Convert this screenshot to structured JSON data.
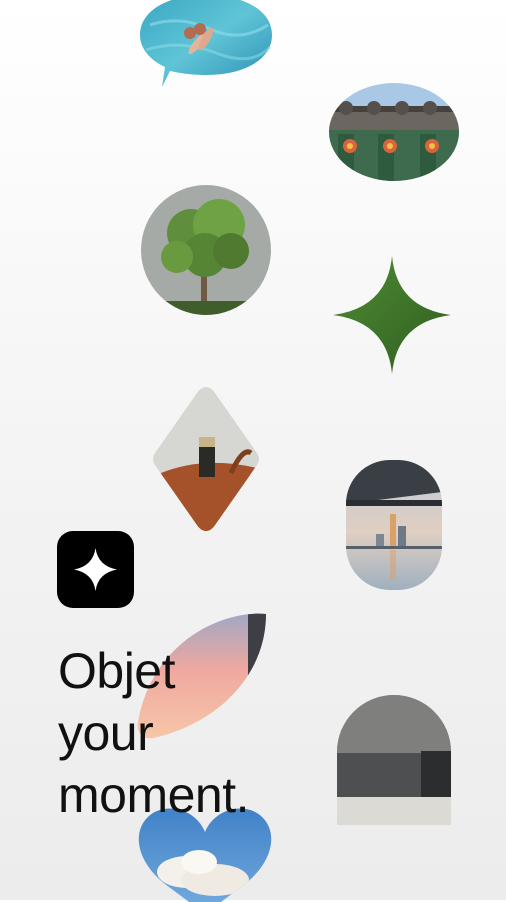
{
  "brand": {
    "icon": "sparkle-icon",
    "accent": "#000000"
  },
  "tagline": {
    "line1": "Objet",
    "line2": "your",
    "line3": "moment."
  },
  "gallery": {
    "items": [
      {
        "shape": "speech-bubble",
        "subject": "pool-water"
      },
      {
        "shape": "oval",
        "subject": "temple-roof"
      },
      {
        "shape": "circle",
        "subject": "tree"
      },
      {
        "shape": "four-point-star",
        "subject": "grass"
      },
      {
        "shape": "diamond",
        "subject": "bottle-in-basket"
      },
      {
        "shape": "capsule",
        "subject": "river-skyline"
      },
      {
        "shape": "leaf",
        "subject": "sunset-sky"
      },
      {
        "shape": "arch",
        "subject": "building-wall"
      },
      {
        "shape": "heart",
        "subject": "clouds"
      }
    ]
  }
}
